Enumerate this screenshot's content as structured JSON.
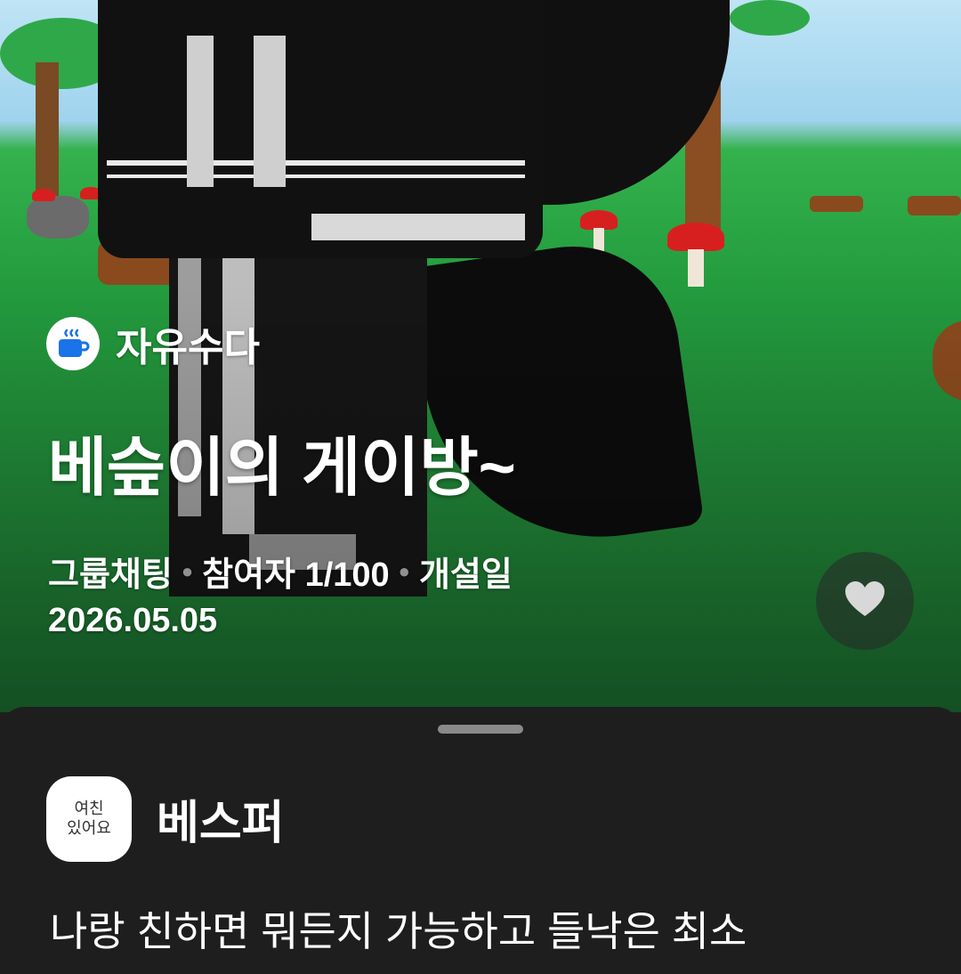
{
  "room": {
    "category_label": "자유수다",
    "category_icon": "coffee-cup-icon",
    "title": "베슾이의 게이방~",
    "chat_type": "그룹채팅",
    "participants": "참여자 1/100",
    "created_label": "개설일",
    "created_date": "2026.05.05"
  },
  "like_icon": "heart-icon",
  "owner": {
    "avatar_text_line1": "여친",
    "avatar_text_line2": "있어요",
    "name": "베스퍼"
  },
  "description": "나랑 친하면 뭐든지 가능하고 들낙은 최소",
  "colors": {
    "category_icon_blue": "#1a73e8",
    "sheet_background": "#1e1e1e"
  }
}
